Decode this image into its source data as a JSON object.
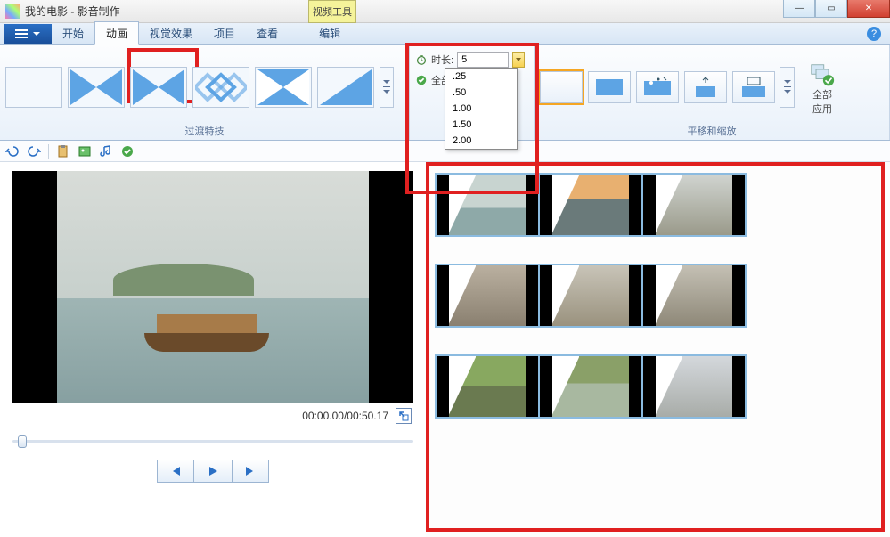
{
  "title": "我的电影 - 影音制作",
  "tool_tab": "视频工具",
  "tabs": {
    "home": "开始",
    "animation": "动画",
    "visual": "视觉效果",
    "project": "项目",
    "view": "查看",
    "edit": "编辑"
  },
  "ribbon": {
    "transitions_label": "过渡特技",
    "panzoom_label": "平移和缩放",
    "duration_label": "时长:",
    "duration_value": "5",
    "apply_all_prefix": "全部应",
    "apply_all_line1": "全部",
    "apply_all_line2": "应用",
    "duration_options": [
      ".25",
      ".50",
      "1.00",
      "1.50",
      "2.00"
    ],
    "transition_thumbs": [
      "none",
      "cross",
      "star",
      "diamond",
      "cross-white",
      "wipe"
    ],
    "pan_thumbs": [
      "none",
      "zoom-in",
      "sparkle",
      "pan-up",
      "pan-center"
    ]
  },
  "preview": {
    "time": "00:00.00/00:50.17"
  },
  "storyboard": {
    "rows": [
      [
        "lake-boat",
        "sunset-river",
        "ruins-pillar"
      ],
      [
        "stone-fountain",
        "circular-pool",
        "columns"
      ],
      [
        "garden-trees",
        "temple-trees",
        "marble-ruins"
      ]
    ]
  }
}
